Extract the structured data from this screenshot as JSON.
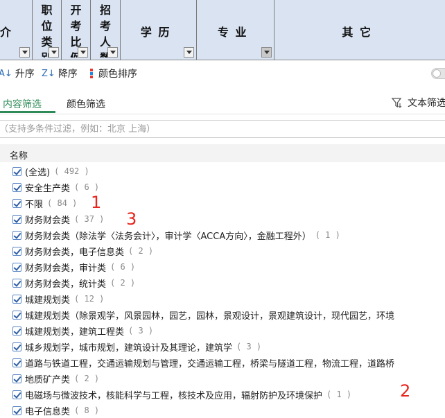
{
  "columns": [
    {
      "label": "介",
      "vertical": false
    },
    {
      "label": "职位类别",
      "vertical": true
    },
    {
      "label": "开考比例",
      "vertical": true
    },
    {
      "label": "招考人数",
      "vertical": true
    },
    {
      "label": "学历",
      "vertical": false
    },
    {
      "label": "专业",
      "vertical": false
    },
    {
      "label": "其它",
      "vertical": false
    }
  ],
  "sort_bar": {
    "ascending": "升序",
    "descending": "降序",
    "color_sort": "颜色排序"
  },
  "tabs": {
    "content_filter": "内容筛选",
    "color_filter": "颜色筛选",
    "text_filter": "文本筛选"
  },
  "search": {
    "placeholder": "（支持多条件过滤，例如：北京 上海）"
  },
  "list": {
    "header": "名称",
    "items": [
      {
        "label": "(全选)",
        "count": "( 492 )"
      },
      {
        "label": "安全生产类",
        "count": "( 6 )"
      },
      {
        "label": "不限",
        "count": "( 84 )"
      },
      {
        "label": "财务财会类",
        "count": "( 37 )"
      },
      {
        "label": "财务财会类（除法学〈法务会计〉，审计学〈ACCA方向〉，金融工程外）",
        "count": "( 1 )"
      },
      {
        "label": "财务财会类，电子信息类",
        "count": "( 2 )"
      },
      {
        "label": "财务财会类，审计类",
        "count": "( 6 )"
      },
      {
        "label": "财务财会类，统计类",
        "count": "( 2 )"
      },
      {
        "label": "城建规划类",
        "count": "( 12 )"
      },
      {
        "label": "城建规划类（除景观学，风景园林，园艺，园林，景观设计，景观建筑设计，现代园艺，环境",
        "count": ""
      },
      {
        "label": "城建规划类，建筑工程类",
        "count": "( 3 )"
      },
      {
        "label": "城乡规划学，城市规划，建筑设计及其理论，建筑学",
        "count": "( 3 )"
      },
      {
        "label": "道路与铁道工程，交通运输规划与管理，交通运输工程，桥梁与隧道工程，物流工程，道路桥",
        "count": ""
      },
      {
        "label": "地质矿产类",
        "count": "( 2 )"
      },
      {
        "label": "电磁场与微波技术，核能科学与工程，核技术及应用，辐射防护及环境保护",
        "count": "( 1 )"
      },
      {
        "label": "电子信息类",
        "count": "( 8 )"
      }
    ]
  },
  "annotations": [
    "1",
    "3",
    "2"
  ],
  "colors": {
    "header_bg": "#d9e3f2",
    "accent_green": "#2e8b57",
    "checkbox_blue": "#2e5fa6",
    "annotation_red": "#e8241c"
  }
}
